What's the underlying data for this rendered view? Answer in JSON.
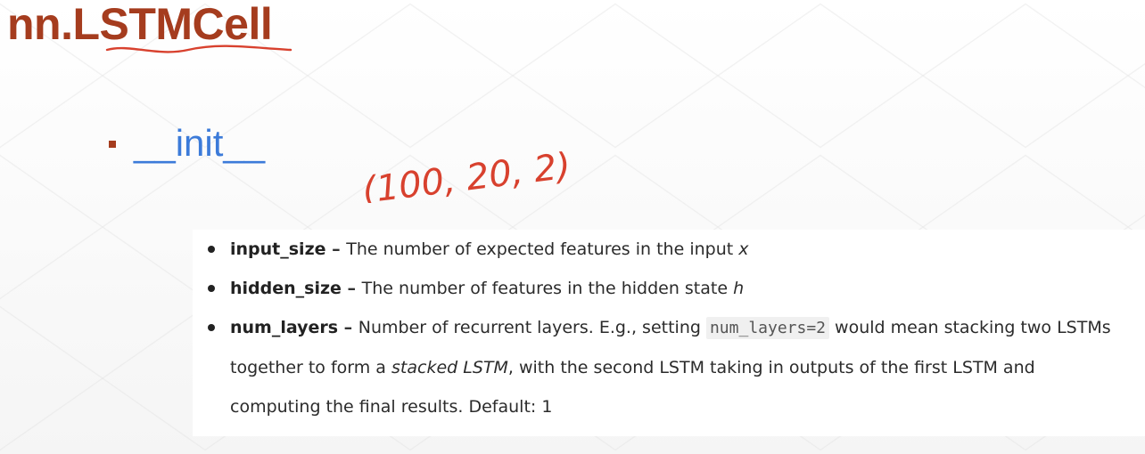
{
  "title": "nn.LSTMCell",
  "section": {
    "bullet_icon": "square-bullet-icon",
    "label": "__init__"
  },
  "annotation": {
    "text": "(100, 20, 2)"
  },
  "params": [
    {
      "name": "input_size",
      "dash": " – ",
      "text": "The number of expected features in the input ",
      "var": "x"
    },
    {
      "name": "hidden_size",
      "dash": " – ",
      "text": "The number of features in the hidden state ",
      "var": "h"
    },
    {
      "name": "num_layers",
      "dash": " – ",
      "text_1": "Number of recurrent layers. E.g., setting ",
      "code": "num_layers=2",
      "text_2": " would mean stacking two LSTMs together to form a ",
      "em": "stacked LSTM",
      "text_3": ", with the second LSTM taking in outputs of the first LSTM and computing the final results. Default: 1"
    }
  ],
  "colors": {
    "title": "#a53c1e",
    "section_label": "#3c7bd9",
    "annotation_ink": "#d8412e"
  }
}
